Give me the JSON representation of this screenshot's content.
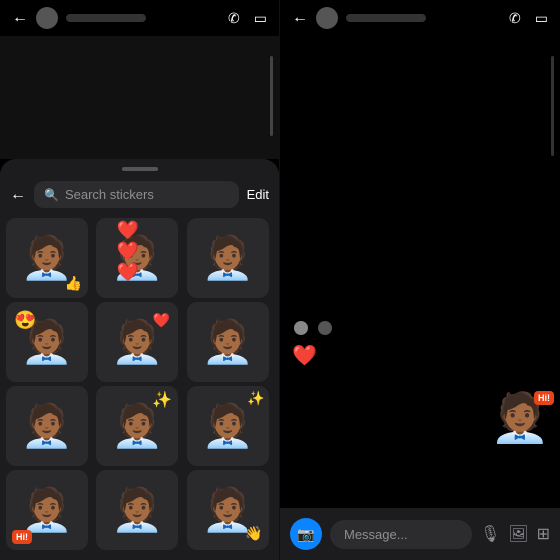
{
  "left": {
    "back_icon": "←",
    "contact_avatar": "",
    "phone_icon": "📞",
    "video_icon": "⬜",
    "sticker_panel": {
      "back_icon": "←",
      "search_placeholder": "Search stickers",
      "edit_label": "Edit",
      "stickers": [
        {
          "id": 1,
          "type": "person",
          "overlay": "👍",
          "overlay_pos": "none"
        },
        {
          "id": 2,
          "type": "person",
          "overlay": "❤️❤️❤️",
          "overlay_pos": "top"
        },
        {
          "id": 3,
          "type": "person",
          "overlay": "none",
          "overlay_pos": "none"
        },
        {
          "id": 4,
          "type": "person",
          "overlay": "😍",
          "overlay_pos": "eyes"
        },
        {
          "id": 5,
          "type": "person",
          "overlay": "❤️",
          "overlay_pos": "right"
        },
        {
          "id": 6,
          "type": "person",
          "overlay": "none",
          "overlay_pos": "none"
        },
        {
          "id": 7,
          "type": "person",
          "overlay": "none",
          "overlay_pos": "none"
        },
        {
          "id": 8,
          "type": "person",
          "overlay": "✨",
          "overlay_pos": "top-right"
        },
        {
          "id": 9,
          "type": "person_sparkle",
          "overlay": "none",
          "overlay_pos": "none"
        },
        {
          "id": 10,
          "type": "person_hi",
          "overlay": "hi",
          "overlay_pos": "bottom-left"
        },
        {
          "id": 11,
          "type": "person",
          "overlay": "none",
          "overlay_pos": "none"
        },
        {
          "id": 12,
          "type": "person_wave",
          "overlay": "none",
          "overlay_pos": "none"
        }
      ]
    }
  },
  "right": {
    "back_icon": "←",
    "phone_icon": "📞",
    "video_icon": "⬜",
    "floating_sticker": "Hi!",
    "reactions": [
      "❤️"
    ],
    "message_bar": {
      "placeholder": "Message...",
      "camera_icon": "📷",
      "mic_icon": "🎤",
      "photo_icon": "🖼",
      "sticker_icon": "🔲"
    }
  }
}
